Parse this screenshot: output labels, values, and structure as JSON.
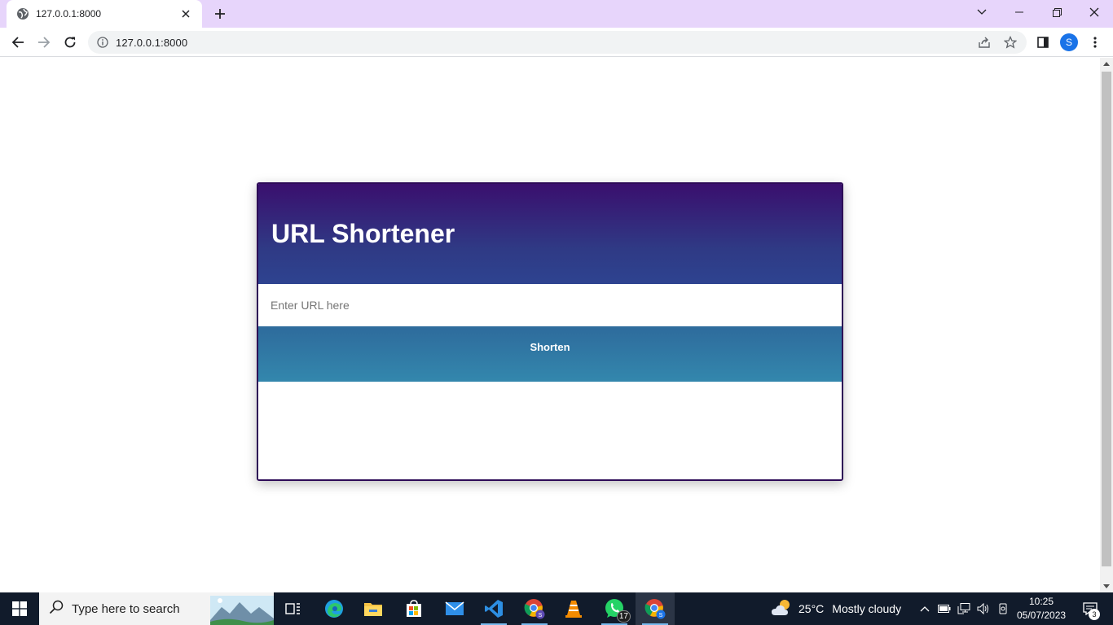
{
  "browser": {
    "tab": {
      "title": "127.0.0.1:8000"
    },
    "address": {
      "url": "127.0.0.1:8000"
    },
    "profile_initial": "S",
    "accent": "#e7d5fb"
  },
  "page": {
    "title": "URL Shortener",
    "input": {
      "placeholder": "Enter URL here",
      "value": ""
    },
    "button": {
      "label": "Shorten"
    },
    "colors": {
      "header_top": "#3a0f6e",
      "header_bottom": "#2e4390",
      "button": "#3387ad",
      "border": "#2d0a57"
    }
  },
  "taskbar": {
    "search_placeholder": "Type here to search",
    "whatsapp_badge": "17",
    "weather": {
      "temp": "25°C",
      "condition": "Mostly cloudy"
    },
    "clock": {
      "time": "10:25",
      "date": "05/07/2023"
    },
    "notifications": "3"
  }
}
